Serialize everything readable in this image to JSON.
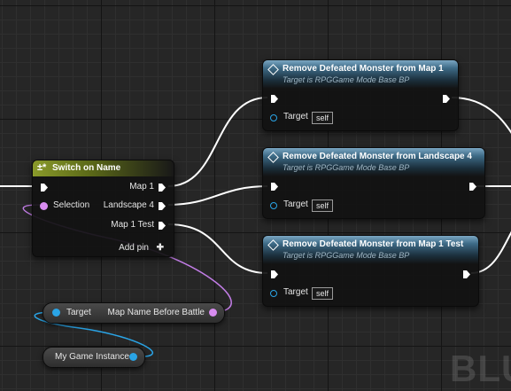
{
  "switch_node": {
    "title": "Switch on Name",
    "icon": "switch-icon",
    "selection_label": "Selection",
    "outputs": [
      "Map 1",
      "Landscape 4",
      "Map 1 Test"
    ],
    "add_pin_label": "Add pin",
    "add_pin_glyph": "✚",
    "header_color": "#8a9a2a"
  },
  "function_nodes": [
    {
      "title": "Remove Defeated Monster from Map 1",
      "subtitle": "Target is RPGGame Mode Base BP",
      "target_label": "Target",
      "target_value": "self"
    },
    {
      "title": "Remove Defeated Monster from Landscape 4",
      "subtitle": "Target is RPGGame Mode Base BP",
      "target_label": "Target",
      "target_value": "self"
    },
    {
      "title": "Remove Defeated Monster from Map 1 Test",
      "subtitle": "Target is RPGGame Mode Base BP",
      "target_label": "Target",
      "target_value": "self"
    }
  ],
  "getter_node": {
    "target_label": "Target",
    "output_label": "Map Name Before Battle",
    "name_pin_color": "#d88cf0",
    "object_pin_color": "#2aa4e6"
  },
  "variable_node": {
    "label": "My Game Instance",
    "pin_color": "#2aa4e6"
  },
  "watermark": "BLU",
  "colors": {
    "exec_wire": "#ffffff",
    "name_wire": "#c27de6",
    "object_wire": "#2aa4e6",
    "function_header": "#3d6a86"
  }
}
